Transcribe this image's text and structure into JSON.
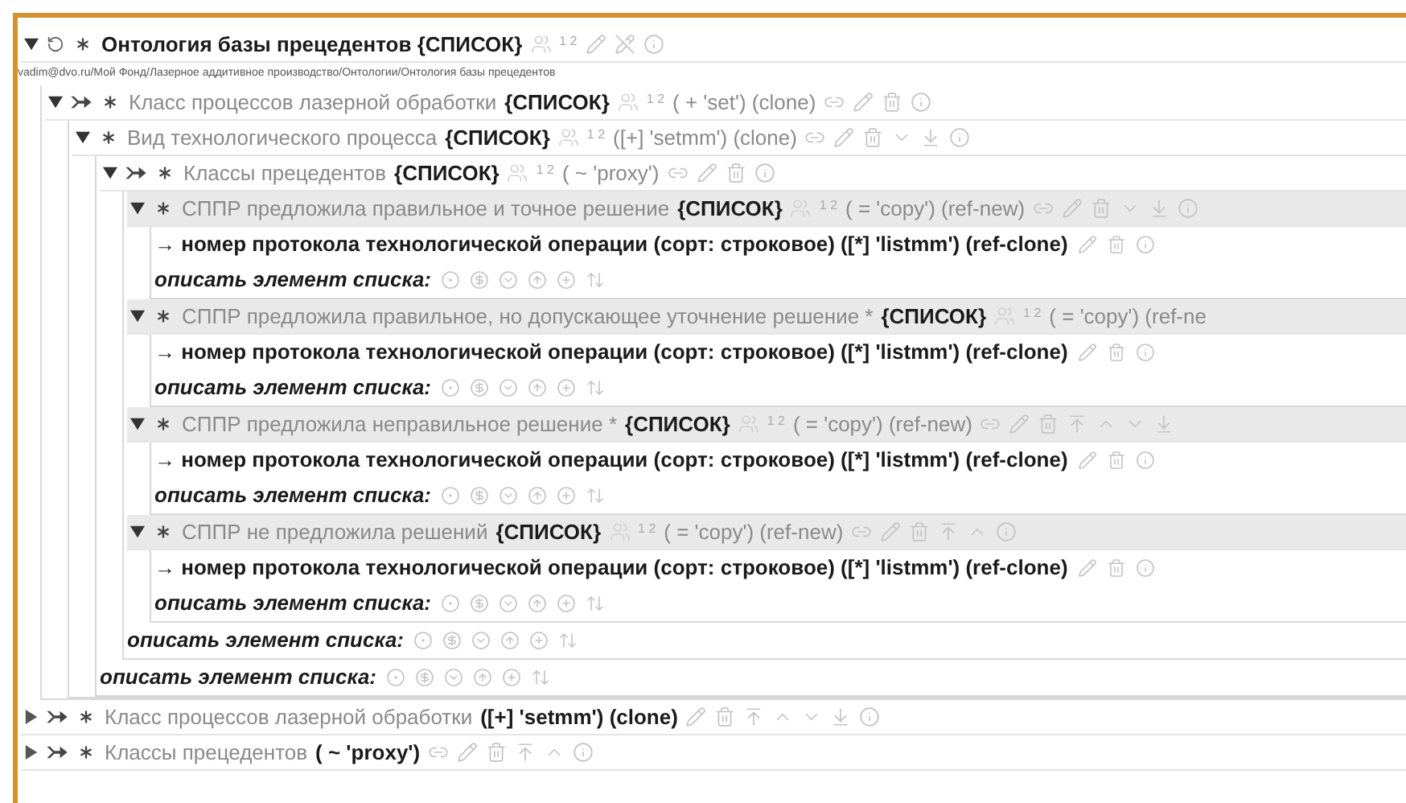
{
  "tree": [
    {
      "kind": "concept",
      "expanded": true,
      "prefix": [
        {
          "kind": "cycle"
        },
        {
          "kind": "star"
        }
      ],
      "segments": [
        {
          "kind": "text",
          "text": "Онтология базы прецедентов {СПИСОК}",
          "bold": true
        },
        {
          "kind": "people"
        },
        {
          "kind": "sup",
          "text": "1 2"
        },
        {
          "kind": "pencil"
        },
        {
          "kind": "pencil-off"
        },
        {
          "kind": "info"
        }
      ],
      "subtitle": "vadim@dvo.ru/Мой Фонд/Лазерное аддитивное производство/Онтологии/Онтология базы прецедентов",
      "children": [
        {
          "kind": "concept",
          "expanded": true,
          "prefix": [
            {
              "kind": "arrow"
            },
            {
              "kind": "star"
            }
          ],
          "segments": [
            {
              "kind": "text",
              "text": "Класс процессов лазерной обработки",
              "bold": false
            },
            {
              "kind": "text",
              "text": "{СПИСОК}",
              "bold": true
            },
            {
              "kind": "people"
            },
            {
              "kind": "sup",
              "text": "1 2"
            },
            {
              "kind": "text",
              "text": "( + 'set') (clone)",
              "bold": false
            },
            {
              "kind": "link"
            },
            {
              "kind": "pencil"
            },
            {
              "kind": "trash"
            },
            {
              "kind": "info"
            }
          ],
          "children": [
            {
              "kind": "concept",
              "expanded": true,
              "prefix": [
                {
                  "kind": "star"
                }
              ],
              "segments": [
                {
                  "kind": "text",
                  "text": "Вид технологического процесса",
                  "bold": false
                },
                {
                  "kind": "text",
                  "text": "{СПИСОК}",
                  "bold": true
                },
                {
                  "kind": "people"
                },
                {
                  "kind": "sup",
                  "text": "1 2"
                },
                {
                  "kind": "text",
                  "text": "([+] 'setmm') (clone)",
                  "bold": false
                },
                {
                  "kind": "link"
                },
                {
                  "kind": "pencil"
                },
                {
                  "kind": "trash"
                },
                {
                  "kind": "down"
                },
                {
                  "kind": "bottom"
                },
                {
                  "kind": "info"
                }
              ],
              "children": [
                {
                  "kind": "concept",
                  "expanded": true,
                  "prefix": [
                    {
                      "kind": "arrow"
                    },
                    {
                      "kind": "star"
                    }
                  ],
                  "segments": [
                    {
                      "kind": "text",
                      "text": "Классы прецедентов",
                      "bold": false
                    },
                    {
                      "kind": "text",
                      "text": "{СПИСОК}",
                      "bold": true
                    },
                    {
                      "kind": "people"
                    },
                    {
                      "kind": "sup",
                      "text": "1 2"
                    },
                    {
                      "kind": "text",
                      "text": "( ~ 'proxy')",
                      "bold": false
                    },
                    {
                      "kind": "link"
                    },
                    {
                      "kind": "pencil"
                    },
                    {
                      "kind": "trash"
                    },
                    {
                      "kind": "info"
                    }
                  ],
                  "children": [
                    {
                      "kind": "concept",
                      "expanded": true,
                      "shaded": true,
                      "prefix": [
                        {
                          "kind": "star"
                        }
                      ],
                      "segments": [
                        {
                          "kind": "text",
                          "text": "СППР предложила правильное и точное решение",
                          "bold": false
                        },
                        {
                          "kind": "text",
                          "text": "{СПИСОК}",
                          "bold": true
                        },
                        {
                          "kind": "people"
                        },
                        {
                          "kind": "sup",
                          "text": "1 2"
                        },
                        {
                          "kind": "text",
                          "text": "( = 'copy') (ref-new)",
                          "bold": false
                        },
                        {
                          "kind": "link"
                        },
                        {
                          "kind": "pencil"
                        },
                        {
                          "kind": "trash"
                        },
                        {
                          "kind": "down"
                        },
                        {
                          "kind": "bottom"
                        },
                        {
                          "kind": "info"
                        }
                      ],
                      "children": [
                        {
                          "kind": "term",
                          "text": "→ номер протокола технологической операции (сорт: строковое) ([*] 'listmm') (ref-clone)"
                        },
                        {
                          "kind": "describe",
                          "text": "описать элемент списка:"
                        }
                      ]
                    },
                    {
                      "kind": "concept",
                      "expanded": true,
                      "shaded": true,
                      "prefix": [
                        {
                          "kind": "star"
                        }
                      ],
                      "segments": [
                        {
                          "kind": "text",
                          "text": "СППР предложила правильное, но допускающее уточнение решение *",
                          "bold": false
                        },
                        {
                          "kind": "text",
                          "text": "{СПИСОК}",
                          "bold": true
                        },
                        {
                          "kind": "people"
                        },
                        {
                          "kind": "sup",
                          "text": "1 2"
                        },
                        {
                          "kind": "text",
                          "text": "( = 'copy') (ref-ne",
                          "bold": false
                        }
                      ],
                      "children": [
                        {
                          "kind": "term",
                          "text": "→ номер протокола технологической операции (сорт: строковое) ([*] 'listmm') (ref-clone)"
                        },
                        {
                          "kind": "describe",
                          "text": "описать элемент списка:"
                        }
                      ]
                    },
                    {
                      "kind": "concept",
                      "expanded": true,
                      "shaded": true,
                      "prefix": [
                        {
                          "kind": "star"
                        }
                      ],
                      "segments": [
                        {
                          "kind": "text",
                          "text": "СППР предложила неправильное решение *",
                          "bold": false
                        },
                        {
                          "kind": "text",
                          "text": "{СПИСОК}",
                          "bold": true
                        },
                        {
                          "kind": "people"
                        },
                        {
                          "kind": "sup",
                          "text": "1 2"
                        },
                        {
                          "kind": "text",
                          "text": "( = 'copy') (ref-new)",
                          "bold": false
                        },
                        {
                          "kind": "link"
                        },
                        {
                          "kind": "pencil"
                        },
                        {
                          "kind": "trash"
                        },
                        {
                          "kind": "top"
                        },
                        {
                          "kind": "up"
                        },
                        {
                          "kind": "down"
                        },
                        {
                          "kind": "bottom"
                        }
                      ],
                      "children": [
                        {
                          "kind": "term",
                          "text": "→ номер протокола технологической операции (сорт: строковое) ([*] 'listmm') (ref-clone)"
                        },
                        {
                          "kind": "describe",
                          "text": "описать элемент списка:"
                        }
                      ]
                    },
                    {
                      "kind": "concept",
                      "expanded": true,
                      "shaded": true,
                      "prefix": [
                        {
                          "kind": "star"
                        }
                      ],
                      "segments": [
                        {
                          "kind": "text",
                          "text": "СППР не предложила решений",
                          "bold": false
                        },
                        {
                          "kind": "text",
                          "text": "{СПИСОК}",
                          "bold": true
                        },
                        {
                          "kind": "people"
                        },
                        {
                          "kind": "sup",
                          "text": "1 2"
                        },
                        {
                          "kind": "text",
                          "text": "( = 'copy') (ref-new)",
                          "bold": false
                        },
                        {
                          "kind": "link"
                        },
                        {
                          "kind": "pencil"
                        },
                        {
                          "kind": "trash"
                        },
                        {
                          "kind": "top"
                        },
                        {
                          "kind": "up"
                        },
                        {
                          "kind": "info"
                        }
                      ],
                      "children": [
                        {
                          "kind": "term",
                          "text": "→ номер протокола технологической операции (сорт: строковое) ([*] 'listmm') (ref-clone)"
                        },
                        {
                          "kind": "describe",
                          "text": "описать элемент списка:"
                        }
                      ]
                    },
                    {
                      "kind": "describe",
                      "text": "описать элемент списка:"
                    }
                  ]
                },
                {
                  "kind": "describe",
                  "text": "описать элемент списка:"
                }
              ]
            }
          ]
        }
      ]
    },
    {
      "kind": "concept",
      "expanded": false,
      "prefix": [
        {
          "kind": "arrow"
        },
        {
          "kind": "star"
        }
      ],
      "segments": [
        {
          "kind": "text",
          "text": "Класс процессов лазерной обработки",
          "bold": false
        },
        {
          "kind": "text",
          "text": "([+] 'setmm') (clone)",
          "bold": true
        },
        {
          "kind": "pencil"
        },
        {
          "kind": "trash"
        },
        {
          "kind": "top"
        },
        {
          "kind": "up"
        },
        {
          "kind": "down"
        },
        {
          "kind": "bottom"
        },
        {
          "kind": "info"
        }
      ]
    },
    {
      "kind": "concept",
      "expanded": false,
      "prefix": [
        {
          "kind": "arrow"
        },
        {
          "kind": "star"
        }
      ],
      "segments": [
        {
          "kind": "text",
          "text": "Классы прецедентов",
          "bold": false
        },
        {
          "kind": "text",
          "text": "( ~ 'proxy')",
          "bold": true
        },
        {
          "kind": "link"
        },
        {
          "kind": "pencil"
        },
        {
          "kind": "trash"
        },
        {
          "kind": "top"
        },
        {
          "kind": "up"
        },
        {
          "kind": "info"
        }
      ]
    }
  ]
}
